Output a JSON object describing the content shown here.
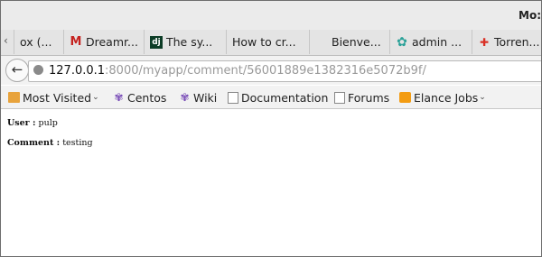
{
  "window": {
    "title": "Mo:"
  },
  "tabs": [
    {
      "label": "ox (...",
      "icon": "none"
    },
    {
      "label": "Dreamr...",
      "icon": "gmail-icon"
    },
    {
      "label": "The sy...",
      "icon": "django-icon"
    },
    {
      "label": "How to cr...",
      "icon": "none"
    },
    {
      "label": "Bienve...",
      "icon": "none"
    },
    {
      "label": "admin ...",
      "icon": "admin-icon"
    },
    {
      "label": "Torren...",
      "icon": "torrent-icon"
    }
  ],
  "nav": {
    "url_host": "127.0.0.1",
    "url_rest": ":8000/myapp/comment/56001889e1382316e5072b9f/"
  },
  "bookmarks": [
    {
      "label": "Most Visited",
      "icon": "folder-icon",
      "dropdown": true
    },
    {
      "label": "Centos",
      "icon": "petal-icon"
    },
    {
      "label": "Wiki",
      "icon": "petal-icon"
    },
    {
      "label": "Documentation",
      "icon": "page-icon"
    },
    {
      "label": "Forums",
      "icon": "page-icon"
    },
    {
      "label": "Elance Jobs",
      "icon": "rss-icon",
      "dropdown": true
    }
  ],
  "content": {
    "user_label": "User :",
    "user_value": "pulp",
    "comment_label": "Comment :",
    "comment_value": "testing"
  }
}
